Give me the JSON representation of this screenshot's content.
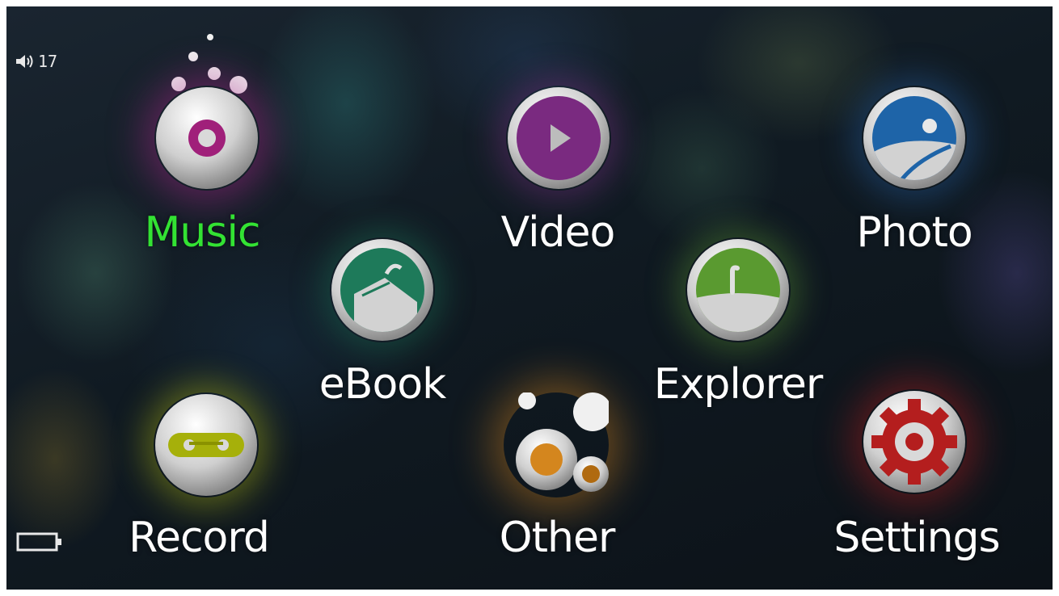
{
  "status": {
    "volume": "17",
    "volume_icon": "speaker-icon",
    "battery_icon": "battery-icon"
  },
  "menu": {
    "selected": "Music",
    "items": [
      {
        "id": "music",
        "label": "Music",
        "icon": "disc-icon",
        "color": "#a0207a",
        "active": true
      },
      {
        "id": "video",
        "label": "Video",
        "icon": "play-icon",
        "color": "#7a2a80",
        "active": false
      },
      {
        "id": "photo",
        "label": "Photo",
        "icon": "landscape-icon",
        "color": "#1e64a8",
        "active": false
      },
      {
        "id": "ebook",
        "label": "eBook",
        "icon": "book-icon",
        "color": "#1e7a5a",
        "active": false
      },
      {
        "id": "explorer",
        "label": "Explorer",
        "icon": "folder-icon",
        "color": "#5a9a30",
        "active": false
      },
      {
        "id": "record",
        "label": "Record",
        "icon": "tape-icon",
        "color": "#a6b00a",
        "active": false
      },
      {
        "id": "other",
        "label": "Other",
        "icon": "bubbles-icon",
        "color": "#d4861e",
        "active": false
      },
      {
        "id": "settings",
        "label": "Settings",
        "icon": "gear-icon",
        "color": "#b41e1e",
        "active": false
      }
    ]
  },
  "colors": {
    "active_label": "#33e233",
    "label": "#ffffff"
  }
}
